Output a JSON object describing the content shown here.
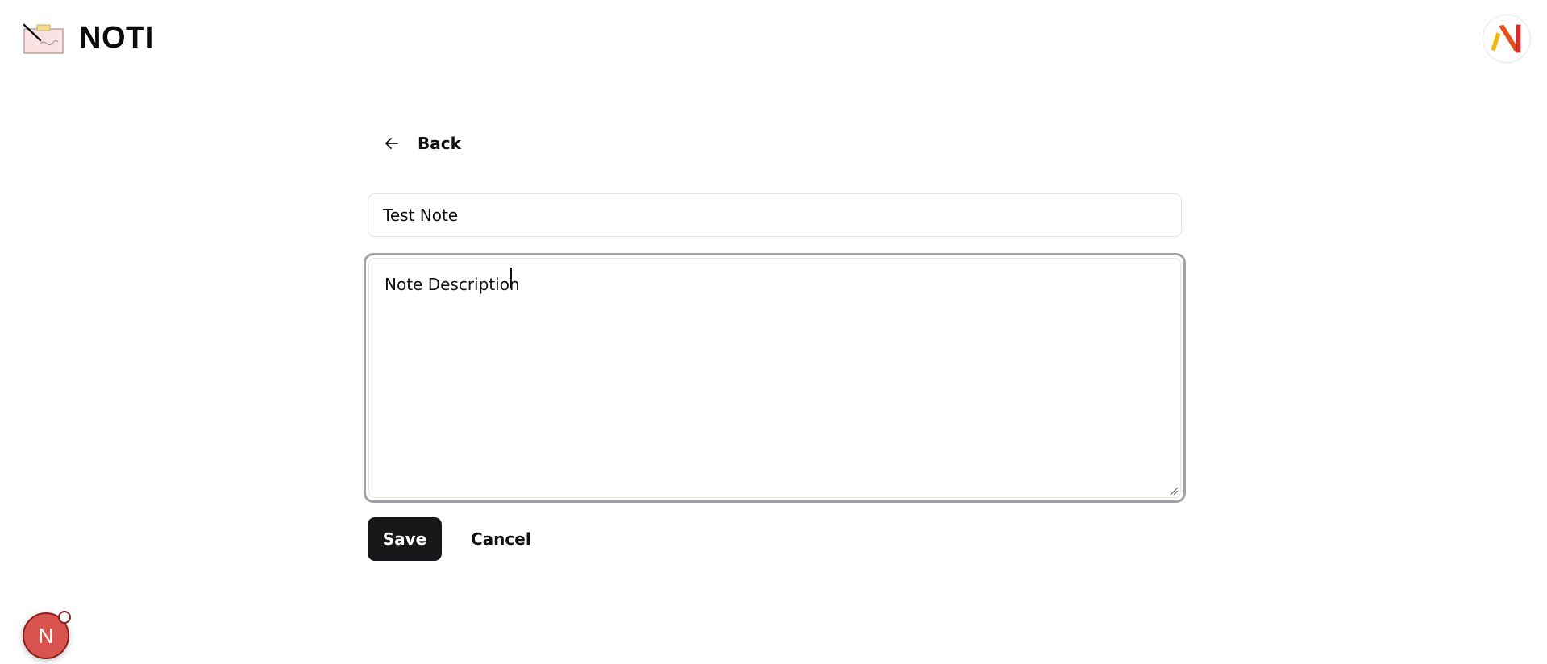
{
  "header": {
    "brand_name": "NOTI",
    "logo_icon": "notepad-pen-icon",
    "avatar_icon": "user-avatar-logo-icon"
  },
  "form": {
    "back_label": "Back",
    "title_value": "Test Note",
    "description_value": "Note Description",
    "save_label": "Save",
    "cancel_label": "Cancel"
  },
  "dev_badge": {
    "letter": "N"
  },
  "colors": {
    "primary_button": "#18181b",
    "focus_ring": "#a1a1aa",
    "input_border": "#e4e4e7",
    "badge": "#d9534f"
  }
}
